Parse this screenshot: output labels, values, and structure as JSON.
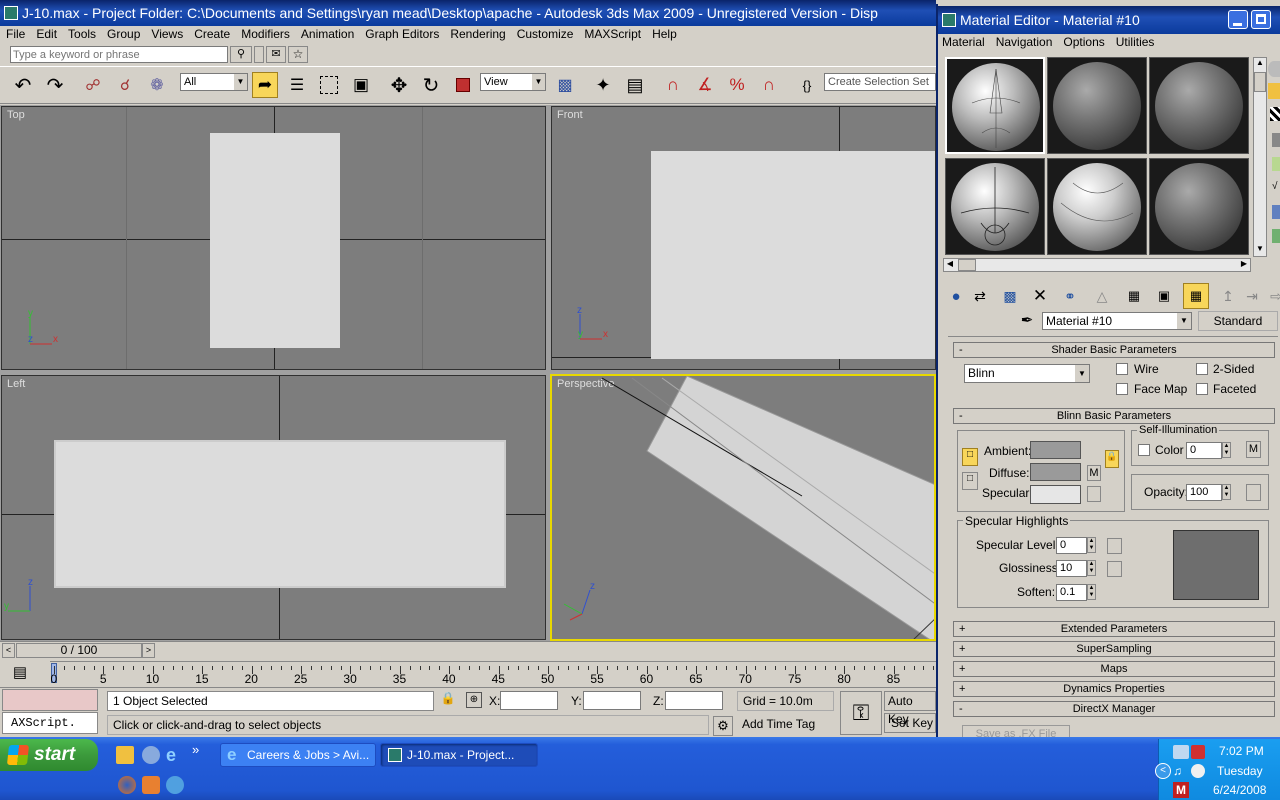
{
  "main_window": {
    "title": "J-10.max     - Project Folder: C:\\Documents and Settings\\ryan mead\\Desktop\\apache      - Autodesk 3ds Max  2009  - Unregistered Version     - Disp",
    "menu": [
      "File",
      "Edit",
      "Tools",
      "Group",
      "Views",
      "Create",
      "Modifiers",
      "Animation",
      "Graph Editors",
      "Rendering",
      "Customize",
      "MAXScript",
      "Help"
    ],
    "search_placeholder": "Type a keyword or phrase",
    "selection_filter": "All",
    "ref_coord": "View",
    "named_selection_placeholder": "Create Selection Set"
  },
  "viewports": {
    "top": "Top",
    "front": "Front",
    "left": "Left",
    "perspective": "Perspective",
    "axis_x": "x",
    "axis_y": "y",
    "axis_z": "z"
  },
  "timeline": {
    "frame": "0 / 100",
    "ticks": [
      "0",
      "5",
      "10",
      "15",
      "20",
      "25",
      "30",
      "35",
      "40",
      "45",
      "50",
      "55",
      "60",
      "65",
      "70",
      "75",
      "80",
      "85"
    ]
  },
  "status": {
    "maxscript": "AXScript.",
    "selected": "1 Object Selected",
    "prompt": "Click or click-and-drag to select objects",
    "x_label": "X:",
    "y_label": "Y:",
    "z_label": "Z:",
    "grid": "Grid = 10.0m",
    "add_time_tag": "Add Time Tag",
    "auto_key": "Auto Key",
    "set_key": "Set Key"
  },
  "material_editor": {
    "title": "Material Editor - Material #10",
    "menu": [
      "Material",
      "Navigation",
      "Options",
      "Utilities"
    ],
    "material_name": "Material #10",
    "material_type": "Standard",
    "shader_rollout": "Shader Basic Parameters",
    "shader": "Blinn",
    "wire": "Wire",
    "two_sided": "2-Sided",
    "face_map": "Face Map",
    "faceted": "Faceted",
    "blinn_rollout": "Blinn Basic Parameters",
    "self_illum_group": "Self-Illumination",
    "ambient": "Ambient:",
    "diffuse": "Diffuse:",
    "specular": "Specular:",
    "color_label": "Color",
    "color_value": "0",
    "opacity_label": "Opacity:",
    "opacity_value": "100",
    "m_label": "M",
    "highlights_group": "Specular Highlights",
    "spec_level_label": "Specular Level:",
    "spec_level": "0",
    "glossiness_label": "Glossiness:",
    "glossiness": "10",
    "soften_label": "Soften:",
    "soften": "0.1",
    "rollouts": [
      "Extended Parameters",
      "SuperSampling",
      "Maps",
      "Dynamics Properties",
      "DirectX Manager"
    ],
    "save_fx": "Save as .FX File",
    "plus": "+",
    "minus": "-"
  },
  "taskbar": {
    "start": "start",
    "tasks": [
      "Careers & Jobs > Avi...",
      "J-10.max      - Project..."
    ],
    "time": "7:02 PM",
    "day": "Tuesday",
    "date": "6/24/2008",
    "expand": "»"
  },
  "colors": {
    "viewport_bg": "#7d7d7d",
    "active_viewport_border": "#e8d800",
    "title_blue": "#0a246a",
    "taskbar_blue": "#245edb",
    "start_green": "#3c9a3c"
  }
}
